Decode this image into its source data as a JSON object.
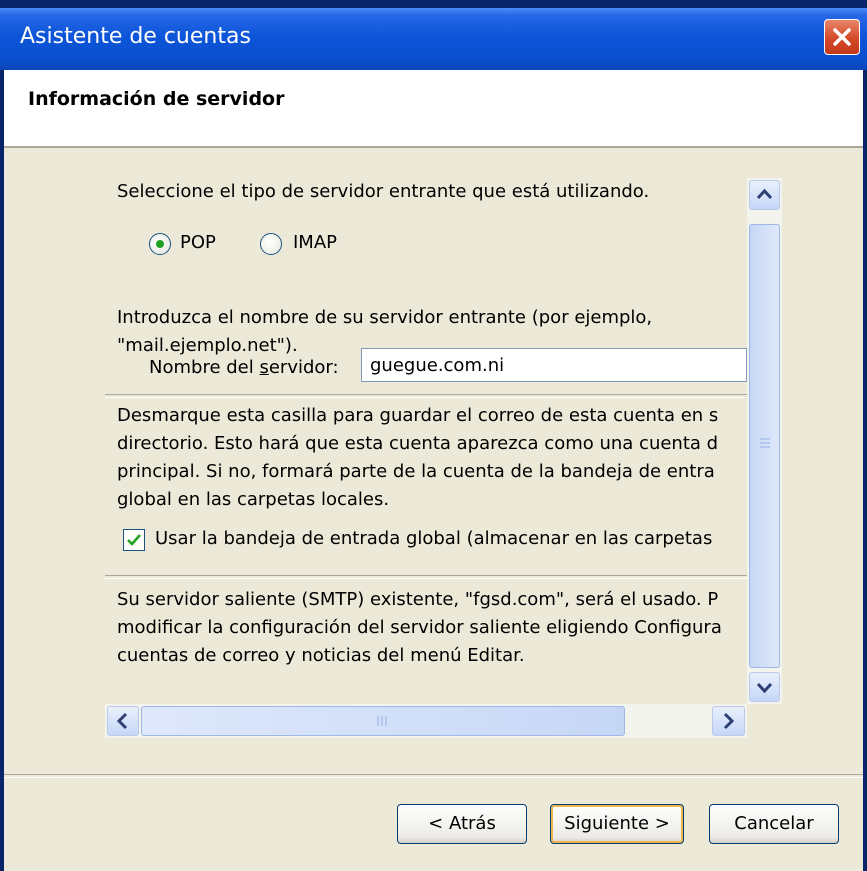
{
  "window": {
    "title": "Asistente de cuentas",
    "close_icon": "close-icon"
  },
  "header": {
    "title": "Información de servidor"
  },
  "server_type": {
    "prompt": "Seleccione el tipo de servidor entrante que está utilizando.",
    "options": [
      {
        "label": "POP",
        "selected": true
      },
      {
        "label": "IMAP",
        "selected": false
      }
    ]
  },
  "server_name": {
    "instruction_line1": "Introduzca el nombre de su servidor entrante (por ejemplo,",
    "instruction_line2": "\"mail.ejemplo.net\").",
    "label_prefix": "Nombre del ",
    "label_accel": "s",
    "label_suffix": "ervidor:",
    "value": "guegue.com.ni"
  },
  "global_inbox": {
    "description_lines": [
      "Desmarque esta casilla para guardar el correo de esta cuenta en s",
      "directorio. Esto hará que esta cuenta aparezca como una cuenta d",
      "principal. Si no, formará parte de la cuenta de la bandeja de entra",
      "global en las carpetas locales."
    ],
    "checkbox_label": "Usar la bandeja de entrada global (almacenar en las carpetas",
    "checked": true
  },
  "smtp_note": {
    "lines": [
      "Su servidor saliente (SMTP) existente, \"fgsd.com\", será el usado. P",
      "modificar la configuración del servidor saliente eligiendo Configura",
      "cuentas de correo y noticias del menú Editar."
    ]
  },
  "buttons": {
    "back": "< Atrás",
    "next": "Siguiente >",
    "cancel": "Cancelar"
  },
  "colors": {
    "title_bar": "#0a4fd0",
    "dialog_bg": "#ece9d8",
    "close_button": "#d44a28",
    "radio_dot": "#21a121"
  }
}
